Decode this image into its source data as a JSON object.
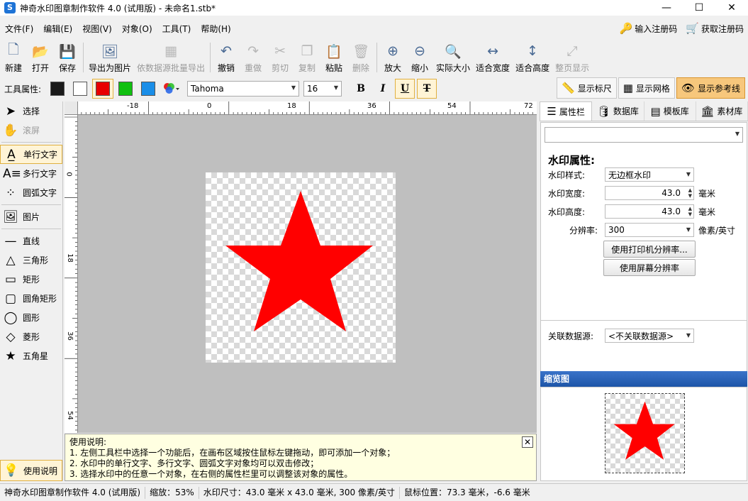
{
  "window": {
    "title": "神奇水印图章制作软件 4.0 (试用版) - 未命名1.stb*",
    "minimize": "—",
    "maximize": "☐",
    "close": "✕"
  },
  "menu": [
    "文件(F)",
    "编辑(E)",
    "视图(V)",
    "对象(O)",
    "工具(T)",
    "帮助(H)"
  ],
  "register": {
    "enter_code": "输入注册码",
    "get_code": "获取注册码"
  },
  "toolbar": [
    {
      "label": "新建",
      "icon": "new-file-icon",
      "glyph": "🗋"
    },
    {
      "label": "打开",
      "icon": "open-icon",
      "glyph": "📂"
    },
    {
      "label": "保存",
      "icon": "save-icon",
      "glyph": "💾"
    },
    {
      "label": "导出为图片",
      "icon": "export-image-icon",
      "glyph": "🖼"
    },
    {
      "label": "依数据源批量导出",
      "icon": "batch-export-icon",
      "glyph": "▦",
      "disabled": true
    },
    {
      "label": "撤销",
      "icon": "undo-icon",
      "glyph": "↶"
    },
    {
      "label": "重做",
      "icon": "redo-icon",
      "glyph": "↷",
      "disabled": true
    },
    {
      "label": "剪切",
      "icon": "cut-icon",
      "glyph": "✂",
      "disabled": true
    },
    {
      "label": "复制",
      "icon": "copy-icon",
      "glyph": "❐",
      "disabled": true
    },
    {
      "label": "粘贴",
      "icon": "paste-icon",
      "glyph": "📋"
    },
    {
      "label": "删除",
      "icon": "delete-icon",
      "glyph": "🗑",
      "disabled": true
    },
    {
      "label": "放大",
      "icon": "zoom-in-icon",
      "glyph": "⊕"
    },
    {
      "label": "缩小",
      "icon": "zoom-out-icon",
      "glyph": "⊖"
    },
    {
      "label": "实际大小",
      "icon": "actual-size-icon",
      "glyph": "🔍"
    },
    {
      "label": "适合宽度",
      "icon": "fit-width-icon",
      "glyph": "↔"
    },
    {
      "label": "适合高度",
      "icon": "fit-height-icon",
      "glyph": "↕"
    },
    {
      "label": "整页显示",
      "icon": "full-page-icon",
      "glyph": "⤢",
      "disabled": true
    }
  ],
  "attrbar": {
    "label": "工具属性:",
    "colors": [
      "#1a1a1a",
      "#ffffff",
      "#e80000",
      "#10c010",
      "#1a8ee8"
    ],
    "selected_color_index": 2,
    "font": "Tahoma",
    "size": "16",
    "bold": "B",
    "italic": "I",
    "underline": "U",
    "strike": "T"
  },
  "view_toggles": [
    {
      "label": "显示标尺",
      "icon": "ruler-icon",
      "glyph": "📏",
      "active": false
    },
    {
      "label": "显示网格",
      "icon": "grid-icon",
      "glyph": "▦",
      "active": false
    },
    {
      "label": "显示参考线",
      "icon": "guide-eye-icon",
      "glyph": "👁",
      "active": true
    }
  ],
  "tools": [
    {
      "label": "选择",
      "icon": "pointer-icon",
      "glyph": "➤"
    },
    {
      "label": "滚屏",
      "icon": "hand-icon",
      "glyph": "✋",
      "disabled": true
    },
    {
      "sep": true
    },
    {
      "label": "单行文字",
      "icon": "single-text-icon",
      "glyph": "A̲",
      "active": true
    },
    {
      "label": "多行文字",
      "icon": "multi-text-icon",
      "glyph": "A≡"
    },
    {
      "label": "圆弧文字",
      "icon": "arc-text-icon",
      "glyph": "⁘"
    },
    {
      "sep": true
    },
    {
      "label": "图片",
      "icon": "picture-icon",
      "glyph": "🖼"
    },
    {
      "sep": true
    },
    {
      "label": "直线",
      "icon": "line-icon",
      "glyph": "—"
    },
    {
      "label": "三角形",
      "icon": "triangle-icon",
      "glyph": "△"
    },
    {
      "label": "矩形",
      "icon": "rectangle-icon",
      "glyph": "▭"
    },
    {
      "label": "圆角矩形",
      "icon": "rounded-rect-icon",
      "glyph": "▢"
    },
    {
      "label": "圆形",
      "icon": "circle-icon",
      "glyph": "◯"
    },
    {
      "label": "菱形",
      "icon": "diamond-icon",
      "glyph": "◇"
    },
    {
      "label": "五角星",
      "icon": "star-icon",
      "glyph": "★"
    }
  ],
  "help_button": "使用说明",
  "ruler": {
    "top_labels": [
      "-18",
      "0",
      "18",
      "36",
      "54",
      "72"
    ],
    "left_labels": [
      "0",
      "18",
      "36",
      "54"
    ]
  },
  "helpbox": {
    "title": "使用说明:",
    "lines": [
      "1. 左侧工具栏中选择一个功能后，在画布区域按住鼠标左键拖动，即可添加一个对象；",
      "2. 水印中的单行文字、多行文字、圆弧文字对象均可以双击修改；",
      "3. 选择水印中的任意一个对象，在右侧的属性栏里可以调整该对象的属性。"
    ]
  },
  "right_panel": {
    "tabs": [
      {
        "label": "属性栏",
        "icon": "properties-icon",
        "glyph": "☰",
        "active": true
      },
      {
        "label": "数据库",
        "icon": "database-icon",
        "glyph": "🛢"
      },
      {
        "label": "模板库",
        "icon": "template-icon",
        "glyph": "▤"
      },
      {
        "label": "素材库",
        "icon": "library-icon",
        "glyph": "🏛"
      }
    ],
    "section_title": "水印属性:",
    "style_label": "水印样式:",
    "style_value": "无边框水印",
    "width_label": "水印宽度:",
    "width_value": "43.0",
    "height_label": "水印高度:",
    "height_value": "43.0",
    "unit_mm": "毫米",
    "dpi_label": "分辨率:",
    "dpi_value": "300",
    "dpi_unit": "像素/英寸",
    "printer_dpi_button": "使用打印机分辨率...",
    "screen_dpi_button": "使用屏幕分辨率",
    "datasource_label": "关联数据源:",
    "datasource_value": "<不关联数据源>",
    "preview_title": "缩览图"
  },
  "status": {
    "app": "神奇水印图章制作软件 4.0 (试用版)",
    "zoom": "缩放：53%",
    "size": "水印尺寸：43.0 毫米 x 43.0 毫米, 300 像素/英寸",
    "mouse": "鼠标位置：73.3 毫米，-6.6 毫米"
  }
}
